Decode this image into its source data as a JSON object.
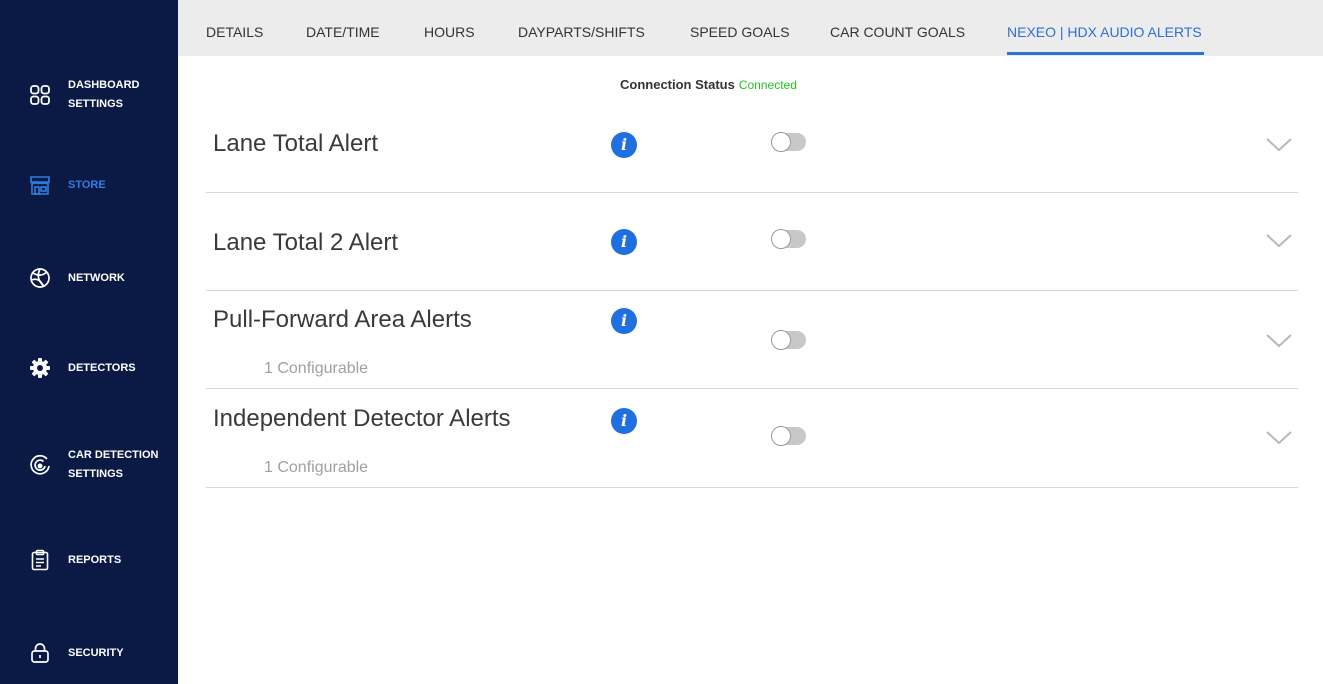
{
  "sidebar": {
    "items": [
      {
        "label": "DASHBOARD SETTINGS",
        "icon": "dashboard-grid-icon"
      },
      {
        "label": "STORE",
        "icon": "store-icon"
      },
      {
        "label": "NETWORK",
        "icon": "network-icon"
      },
      {
        "label": "DETECTORS",
        "icon": "gear-icon"
      },
      {
        "label": "CAR DETECTION SETTINGS",
        "icon": "car-detection-icon"
      },
      {
        "label": "REPORTS",
        "icon": "clipboard-icon"
      },
      {
        "label": "SECURITY",
        "icon": "lock-icon"
      }
    ],
    "active": "STORE",
    "active_color": "#2f7de1",
    "bg_color": "#0b1a45"
  },
  "tabs": {
    "items": [
      "DETAILS",
      "DATE/TIME",
      "HOURS",
      "DAYPARTS/SHIFTS",
      "SPEED GOALS",
      "CAR COUNT GOALS",
      "NEXEO | HDX AUDIO ALERTS"
    ],
    "active": "NEXEO | HDX AUDIO ALERTS",
    "active_color": "#2f6fd8"
  },
  "connection": {
    "label": "Connection Status",
    "value": "Connected",
    "value_color": "#1ec41e"
  },
  "alerts": [
    {
      "title": "Lane Total Alert",
      "subtitle": "",
      "enabled": false
    },
    {
      "title": "Lane Total 2 Alert",
      "subtitle": "",
      "enabled": false
    },
    {
      "title": "Pull-Forward Area Alerts",
      "subtitle": "1 Configurable",
      "enabled": false
    },
    {
      "title": "Independent Detector Alerts",
      "subtitle": "1 Configurable",
      "enabled": false
    }
  ],
  "info_icon": "info-icon",
  "info_color": "#1f6fe0"
}
